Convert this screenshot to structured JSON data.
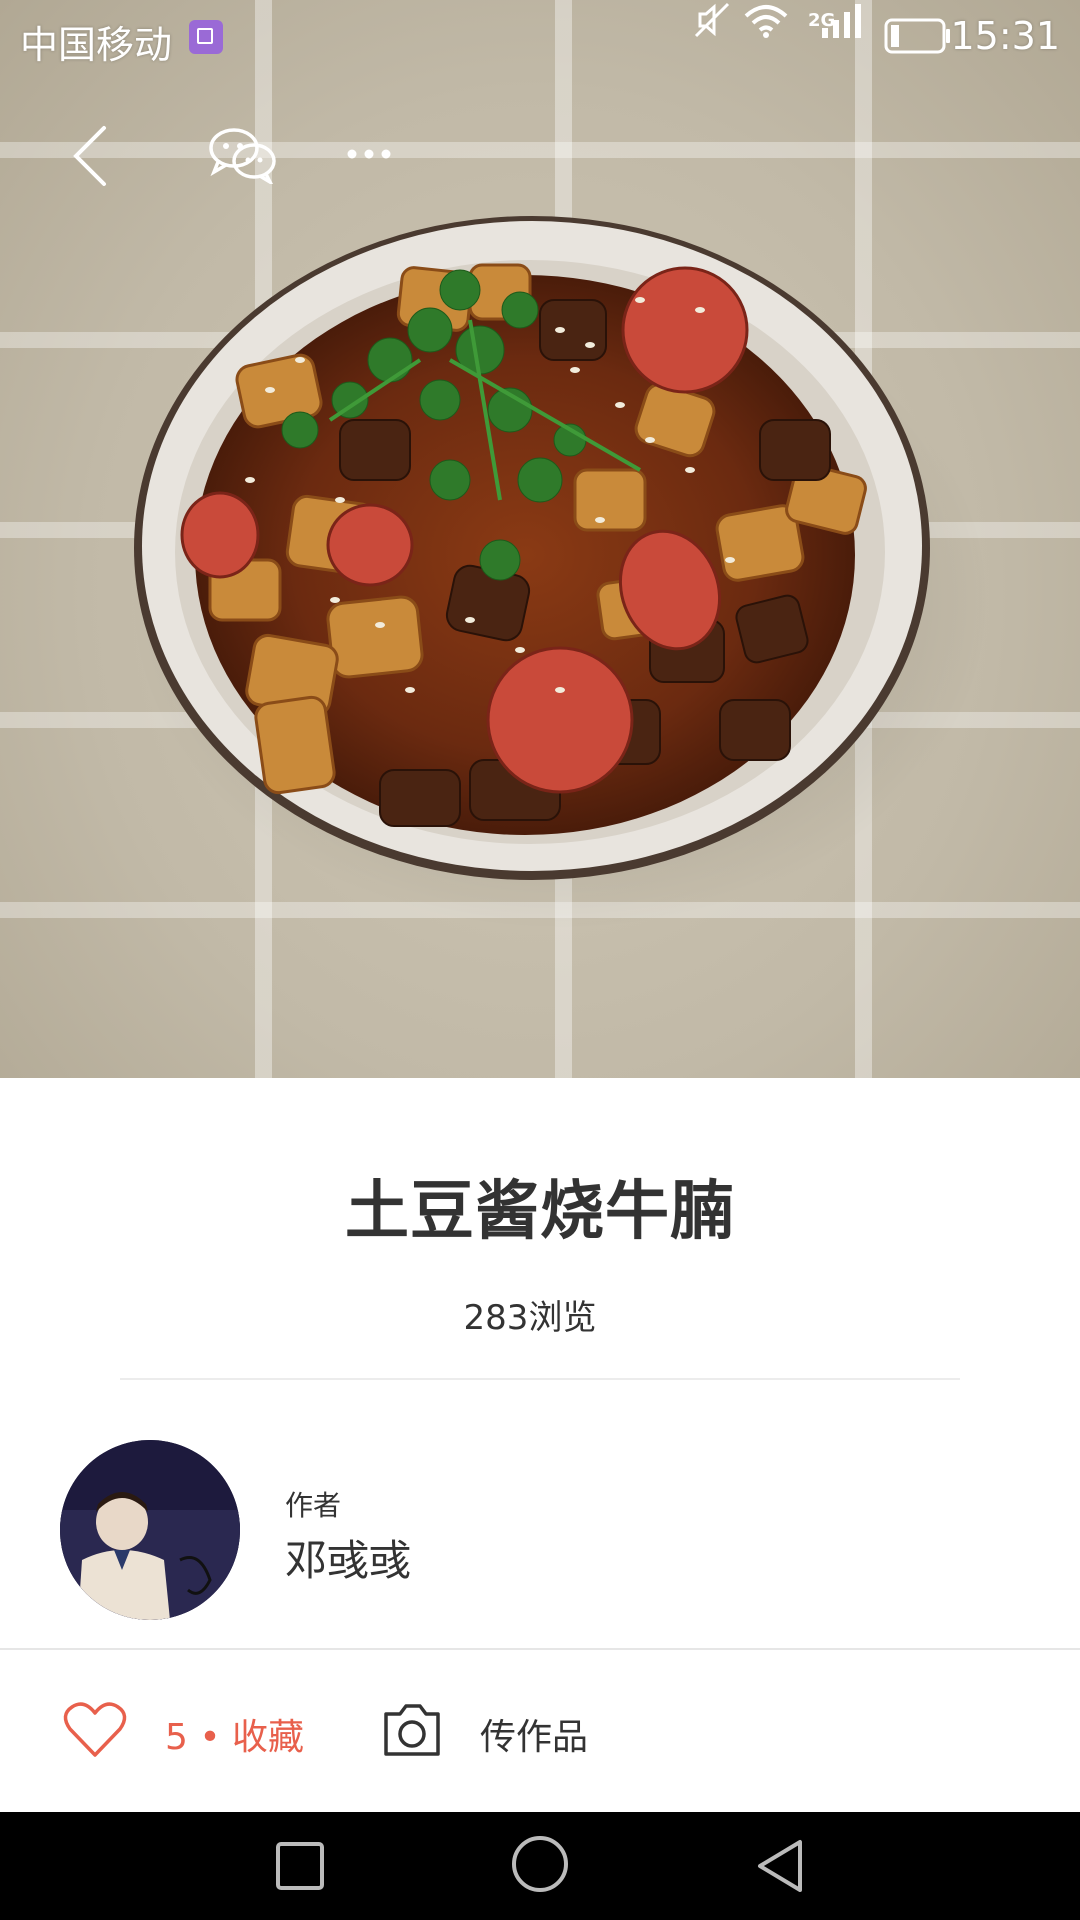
{
  "status_bar": {
    "carrier": "中国移动",
    "network_type": "2G",
    "time": "15:31",
    "icons": [
      "gallery-notification-icon",
      "mute-icon",
      "wifi-icon",
      "signal-icon",
      "battery-icon"
    ]
  },
  "toolbar": {
    "icons": [
      "back-icon",
      "wechat-share-icon",
      "more-icon"
    ]
  },
  "recipe": {
    "title": "土豆酱烧牛腩",
    "views": "283浏览"
  },
  "author": {
    "label": "作者",
    "name": "邓彧彧"
  },
  "actions": {
    "favorite": "5 • 收藏",
    "upload": "传作品"
  },
  "nav_bar": {
    "icons": [
      "recents-icon",
      "home-icon",
      "back-nav-icon"
    ]
  },
  "colors": {
    "accent": "#e8604c",
    "text": "#333333",
    "divider": "#ececec"
  }
}
